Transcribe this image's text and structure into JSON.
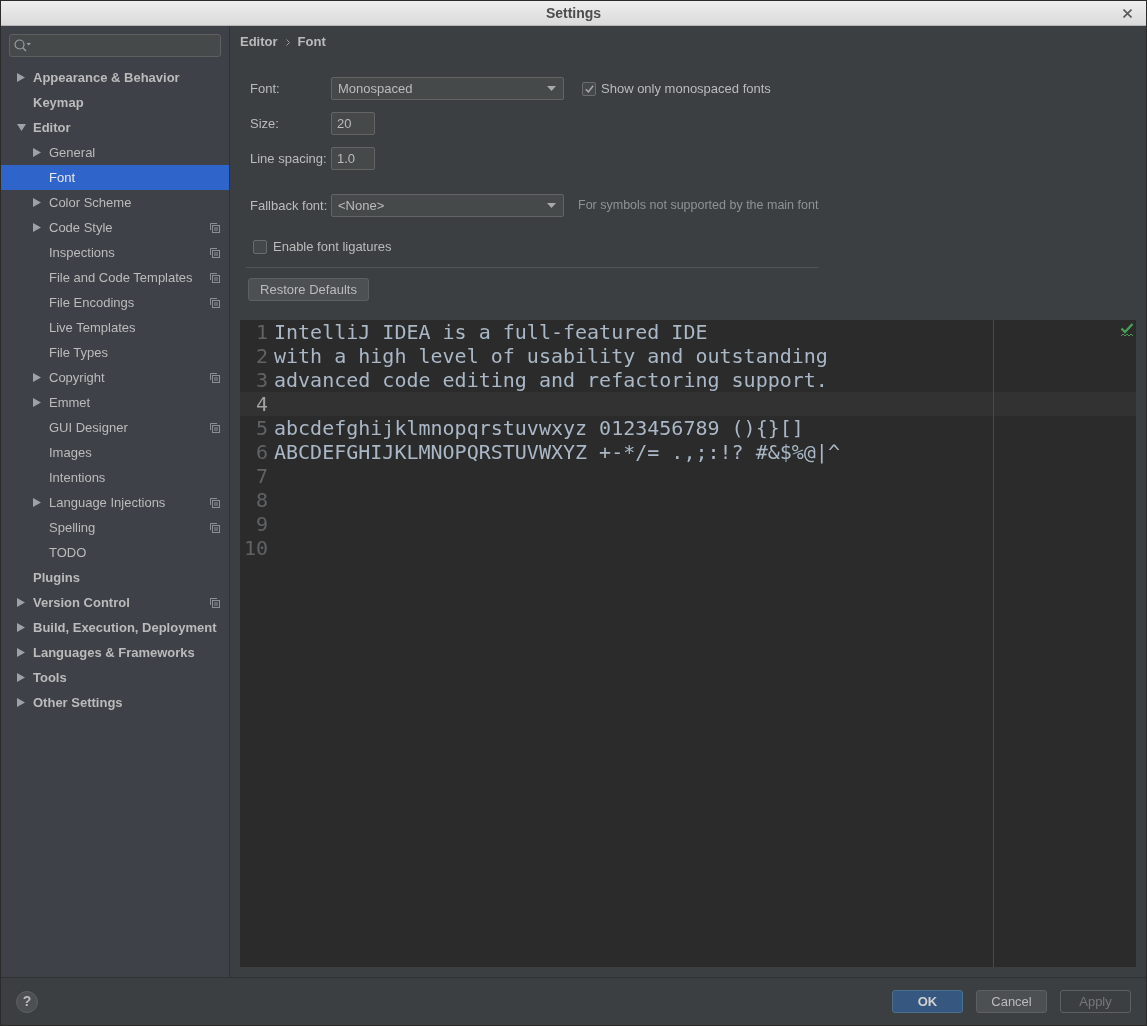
{
  "window": {
    "title": "Settings"
  },
  "sidebar": {
    "items": [
      {
        "label": "Appearance & Behavior",
        "expandable": true,
        "expanded": false,
        "per_project": false,
        "selected": false
      },
      {
        "label": "Keymap",
        "expandable": false,
        "expanded": false,
        "per_project": false,
        "selected": false
      },
      {
        "label": "Editor",
        "expandable": true,
        "expanded": true,
        "per_project": false,
        "selected": false,
        "children": [
          {
            "label": "General",
            "expandable": true,
            "expanded": false,
            "per_project": false,
            "selected": false
          },
          {
            "label": "Font",
            "expandable": false,
            "expanded": false,
            "per_project": false,
            "selected": true
          },
          {
            "label": "Color Scheme",
            "expandable": true,
            "expanded": false,
            "per_project": false,
            "selected": false
          },
          {
            "label": "Code Style",
            "expandable": true,
            "expanded": false,
            "per_project": true,
            "selected": false
          },
          {
            "label": "Inspections",
            "expandable": false,
            "expanded": false,
            "per_project": true,
            "selected": false
          },
          {
            "label": "File and Code Templates",
            "expandable": false,
            "expanded": false,
            "per_project": true,
            "selected": false
          },
          {
            "label": "File Encodings",
            "expandable": false,
            "expanded": false,
            "per_project": true,
            "selected": false
          },
          {
            "label": "Live Templates",
            "expandable": false,
            "expanded": false,
            "per_project": false,
            "selected": false
          },
          {
            "label": "File Types",
            "expandable": false,
            "expanded": false,
            "per_project": false,
            "selected": false
          },
          {
            "label": "Copyright",
            "expandable": true,
            "expanded": false,
            "per_project": true,
            "selected": false
          },
          {
            "label": "Emmet",
            "expandable": true,
            "expanded": false,
            "per_project": false,
            "selected": false
          },
          {
            "label": "GUI Designer",
            "expandable": false,
            "expanded": false,
            "per_project": true,
            "selected": false
          },
          {
            "label": "Images",
            "expandable": false,
            "expanded": false,
            "per_project": false,
            "selected": false
          },
          {
            "label": "Intentions",
            "expandable": false,
            "expanded": false,
            "per_project": false,
            "selected": false
          },
          {
            "label": "Language Injections",
            "expandable": true,
            "expanded": false,
            "per_project": true,
            "selected": false
          },
          {
            "label": "Spelling",
            "expandable": false,
            "expanded": false,
            "per_project": true,
            "selected": false
          },
          {
            "label": "TODO",
            "expandable": false,
            "expanded": false,
            "per_project": false,
            "selected": false
          }
        ]
      },
      {
        "label": "Plugins",
        "expandable": false,
        "expanded": false,
        "per_project": false,
        "selected": false
      },
      {
        "label": "Version Control",
        "expandable": true,
        "expanded": false,
        "per_project": true,
        "selected": false
      },
      {
        "label": "Build, Execution, Deployment",
        "expandable": true,
        "expanded": false,
        "per_project": false,
        "selected": false
      },
      {
        "label": "Languages & Frameworks",
        "expandable": true,
        "expanded": false,
        "per_project": false,
        "selected": false
      },
      {
        "label": "Tools",
        "expandable": true,
        "expanded": false,
        "per_project": false,
        "selected": false
      },
      {
        "label": "Other Settings",
        "expandable": true,
        "expanded": false,
        "per_project": false,
        "selected": false
      }
    ]
  },
  "breadcrumb": [
    "Editor",
    "Font"
  ],
  "font_settings": {
    "font": {
      "label": "Font:",
      "value": "Monospaced"
    },
    "monospaced_only": {
      "label": "Show only monospaced fonts",
      "checked": true
    },
    "size": {
      "label": "Size:",
      "value": "20"
    },
    "line_spacing": {
      "label": "Line spacing:",
      "value": "1.0"
    },
    "fallback_font": {
      "label": "Fallback font:",
      "value": "<None>",
      "hint": "For symbols not supported by the main font"
    },
    "ligatures": {
      "label": "Enable font ligatures",
      "checked": false
    },
    "restore_button": "Restore Defaults"
  },
  "preview": {
    "lines": [
      {
        "number": "1",
        "text": "IntelliJ IDEA is a full-featured IDE",
        "current": false
      },
      {
        "number": "2",
        "text": "with a high level of usability and outstanding",
        "current": false
      },
      {
        "number": "3",
        "text": "advanced code editing and refactoring support.",
        "current": false
      },
      {
        "number": "4",
        "current": true
      },
      {
        "number": "5",
        "text": "abcdefghijklmnopqrstuvwxyz 0123456789 (){}[]",
        "current": false
      },
      {
        "number": "6",
        "text": "ABCDEFGHIJKLMNOPQRSTUVWXYZ +-*/= .,;:!? #&$%@|^",
        "current": false
      },
      {
        "number": "7",
        "current": false
      },
      {
        "number": "8",
        "current": false
      },
      {
        "number": "9",
        "current": false
      },
      {
        "number": "10",
        "current": false
      }
    ]
  },
  "footer": {
    "help": "?",
    "buttons": [
      {
        "label": "OK",
        "primary": true,
        "disabled": false
      },
      {
        "label": "Cancel",
        "primary": false,
        "disabled": false
      },
      {
        "label": "Apply",
        "primary": false,
        "disabled": true
      }
    ]
  }
}
